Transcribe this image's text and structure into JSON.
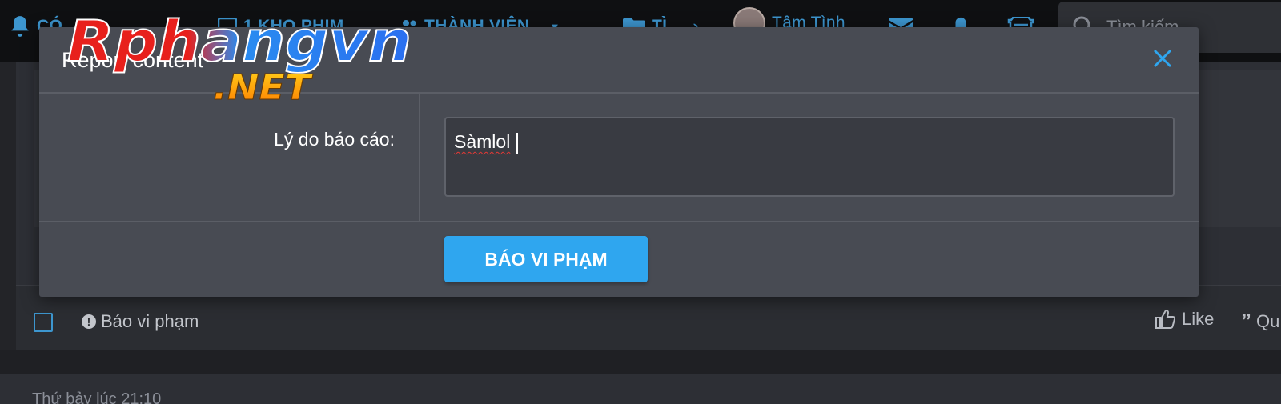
{
  "nav": {
    "items": [
      {
        "label": "CÓ",
        "icon": "bell-icon"
      },
      {
        "label": "1 KHO PHIM",
        "icon": "monitor-icon"
      },
      {
        "label": "THÀNH VIÊN",
        "icon": "users-icon"
      },
      {
        "label": "TÌ",
        "icon": "folder-icon"
      }
    ],
    "user_name": "Tâm Tình",
    "search_placeholder": "Tìm kiếm..."
  },
  "modal": {
    "title": "Report content",
    "field_label": "Lý do báo cáo:",
    "field_value": "Sàmlol",
    "submit_label": "BÁO VI PHẠM"
  },
  "post": {
    "report_label": "Báo vi phạm",
    "like_label": "Like",
    "quote_label": "Qu",
    "next_post_timestamp": "Thứ bảy lúc 21:10"
  },
  "watermark": {
    "line1": "Rphangvn",
    "line2": ".NET"
  },
  "colors": {
    "accent": "#2fa6ef",
    "modal_bg": "#484b53",
    "link_blue": "#3d96cf"
  }
}
